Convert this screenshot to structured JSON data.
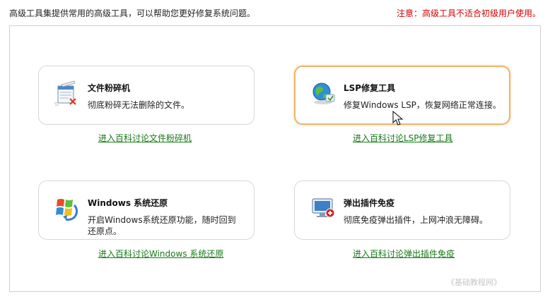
{
  "header": {
    "intro": "高级工具集提供常用的高级工具，可以帮助您更好修复系统问题。",
    "warning": "注意：高级工具不适合初级用户使用。"
  },
  "tools": [
    {
      "title": "文件粉碎机",
      "desc": "彻底粉碎无法删除的文件。",
      "link": "进入百科讨论文件粉碎机",
      "icon": "file-shredder-icon"
    },
    {
      "title": "LSP修复工具",
      "desc": "修复Windows LSP，恢复网络正常连接。",
      "link": "进入百科讨论LSP修复工具",
      "icon": "lsp-repair-icon"
    },
    {
      "title": "Windows 系统还原",
      "desc": "开启Windows系统还原功能，随时回到还原点。",
      "link": "进入百科讨论Windows 系统还原",
      "icon": "windows-restore-icon"
    },
    {
      "title": "弹出插件免疫",
      "desc": "彻底免疫弹出插件，上网冲浪无障碍。",
      "link": "进入百科讨论弹出插件免疫",
      "icon": "popup-immunity-icon"
    }
  ],
  "watermark": "《基础教程网》",
  "colors": {
    "warning": "#d40000",
    "link": "#177a17",
    "active_border": "#f0b46a"
  }
}
